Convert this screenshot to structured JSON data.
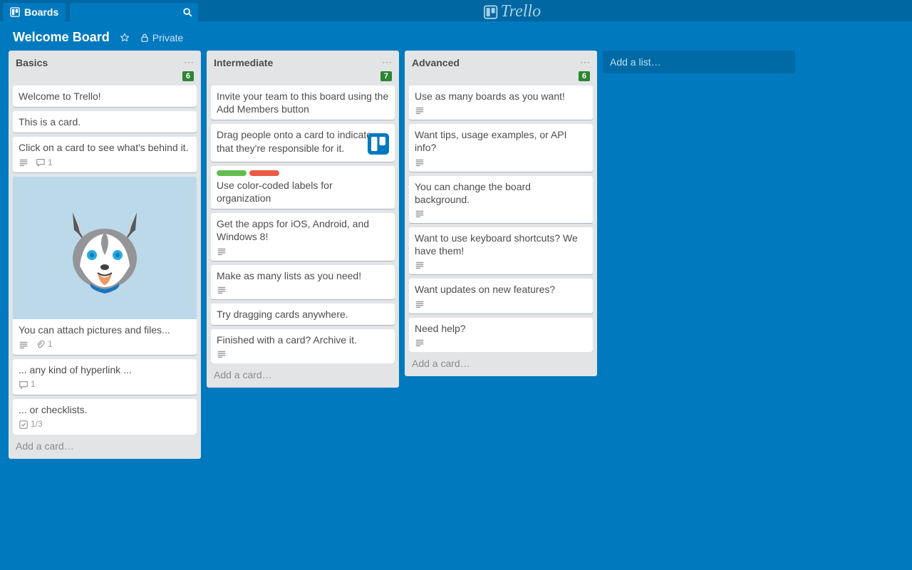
{
  "brand": "Trello",
  "topbar": {
    "boards_label": "Boards",
    "search_placeholder": ""
  },
  "board": {
    "title": "Welcome Board",
    "visibility": "Private"
  },
  "add_list_label": "Add a list…",
  "add_card_label": "Add a card…",
  "lists": [
    {
      "title": "Basics",
      "count": "6",
      "cards": [
        {
          "text": "Welcome to Trello!"
        },
        {
          "text": "This is a card."
        },
        {
          "text": "Click on a card to see what's behind it.",
          "has_desc": true,
          "comments": "1"
        },
        {
          "text": "You can attach pictures and files...",
          "has_desc": true,
          "attachments": "1",
          "has_husky_cover": true
        },
        {
          "text": "... any kind of hyperlink ...",
          "comments": "1"
        },
        {
          "text": "... or checklists.",
          "checklist": "1/3"
        }
      ]
    },
    {
      "title": "Intermediate",
      "count": "7",
      "cards": [
        {
          "text": "Invite your team to this board using the Add Members button"
        },
        {
          "text": "Drag people onto a card to indicate that they're responsible for it.",
          "has_trello_thumb": true
        },
        {
          "text": "Use color-coded labels for organization",
          "labels": [
            "#61bd4f",
            "#eb5a46"
          ]
        },
        {
          "text": "Get the apps for iOS, Android, and Windows 8!",
          "has_desc": true
        },
        {
          "text": "Make as many lists as you need!",
          "has_desc": true
        },
        {
          "text": "Try dragging cards anywhere."
        },
        {
          "text": "Finished with a card? Archive it.",
          "has_desc": true
        }
      ]
    },
    {
      "title": "Advanced",
      "count": "6",
      "cards": [
        {
          "text": "Use as many boards as you want!",
          "has_desc": true
        },
        {
          "text": "Want tips, usage examples, or API info?",
          "has_desc": true
        },
        {
          "text": "You can change the board background.",
          "has_desc": true
        },
        {
          "text": "Want to use keyboard shortcuts? We have them!",
          "has_desc": true
        },
        {
          "text": "Want updates on new features?",
          "has_desc": true
        },
        {
          "text": "Need help?",
          "has_desc": true
        }
      ]
    }
  ]
}
